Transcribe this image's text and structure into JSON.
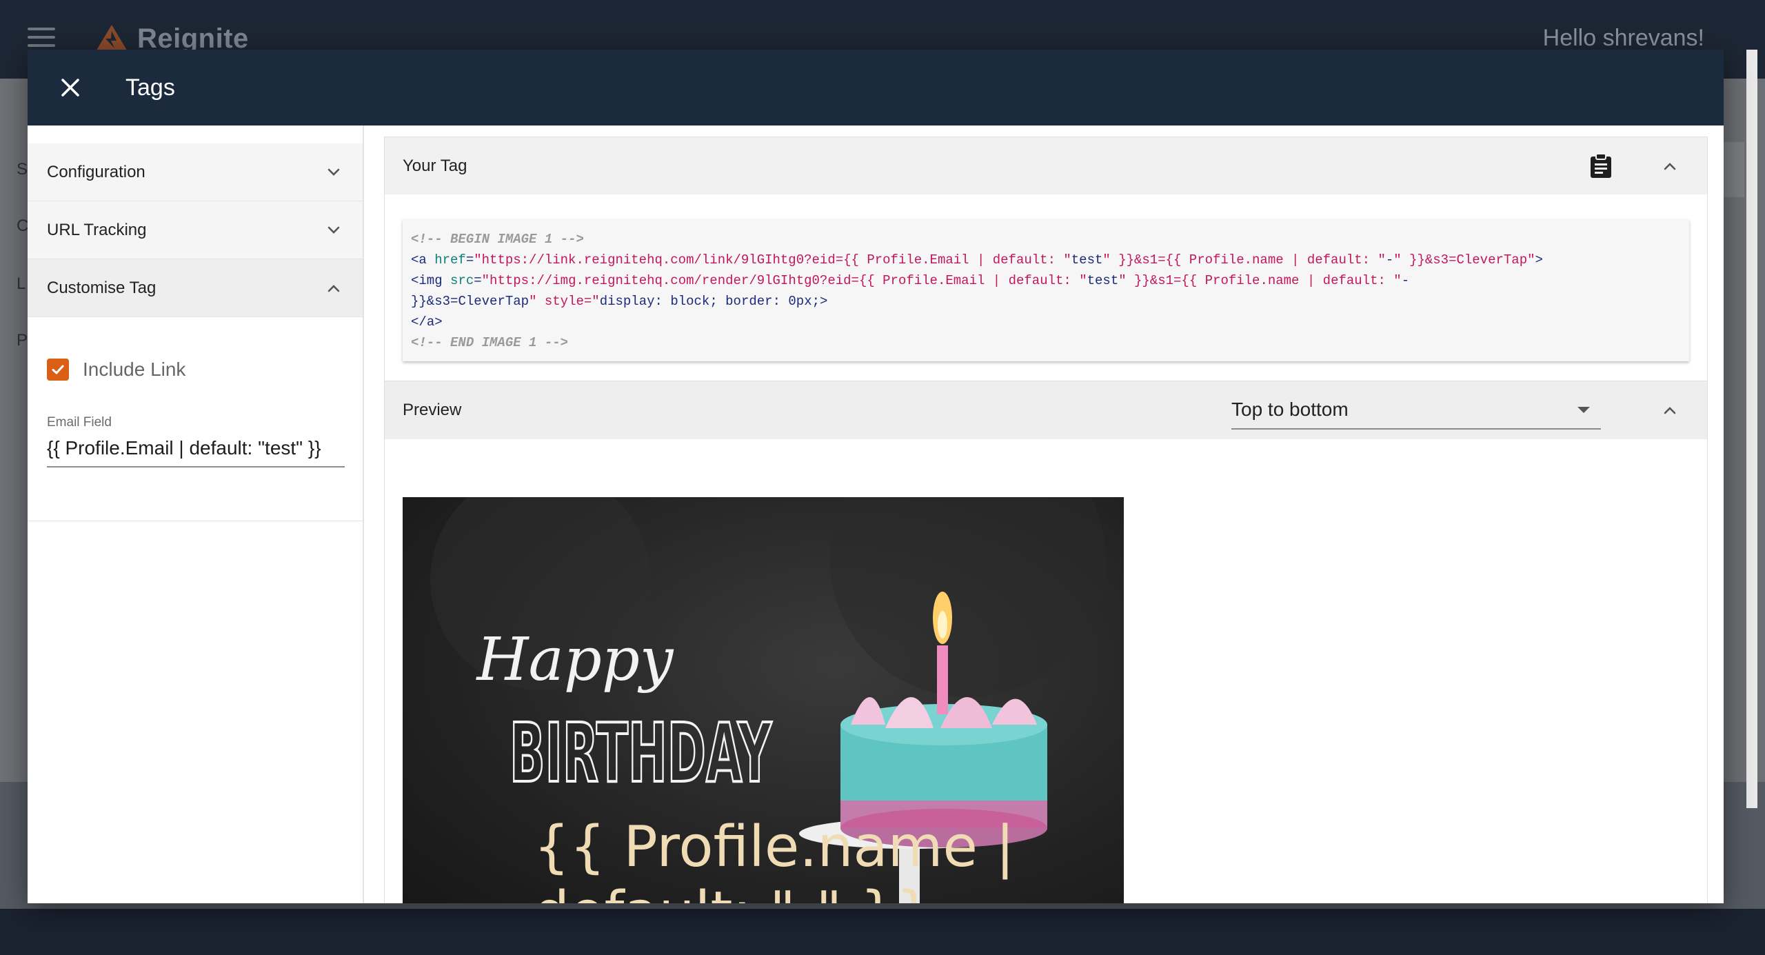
{
  "app": {
    "brand": "Reignite",
    "greeting": "Hello shrevans!",
    "side_letters": [
      "S",
      "C",
      "L",
      "P"
    ]
  },
  "modal": {
    "title": "Tags"
  },
  "left_panel": {
    "sections": [
      {
        "label": "Configuration",
        "expanded": false
      },
      {
        "label": "URL Tracking",
        "expanded": false
      },
      {
        "label": "Customise Tag",
        "expanded": true
      }
    ],
    "include_link": {
      "label": "Include Link",
      "checked": true
    },
    "email_field": {
      "label": "Email Field",
      "value": "{{ Profile.Email | default: \"test\" }}"
    }
  },
  "your_tag": {
    "title": "Your Tag",
    "code_lines": [
      "<!-- BEGIN IMAGE 1 -->",
      "<a href=\"https://link.reignitehq.com/link/9lGIhtg0?eid={{ Profile.Email | default: \"test\" }}&s1={{ Profile.name | default: \"-\" }}&s3=CleverTap\">",
      "<img src=\"https://img.reignitehq.com/render/9lGIhtg0?eid={{ Profile.Email | default: \"test\" }}&s1={{ Profile.name | default: \"-\"",
      "}}&s3=CleverTap\" style=\"display: block; border: 0px;\">",
      "</a>",
      "<!-- END IMAGE 1 -->"
    ]
  },
  "preview": {
    "title": "Preview",
    "direction_select": "Top to bottom",
    "image_text": {
      "line1": "Happy",
      "line2": "BIRTHDAY",
      "line3": "{{ Profile.name |",
      "line4": "default: \"-\" }}"
    }
  },
  "colors": {
    "header_bg": "#1b2a3d",
    "accent": "#d95f16",
    "cake": "#5ec5c3"
  }
}
